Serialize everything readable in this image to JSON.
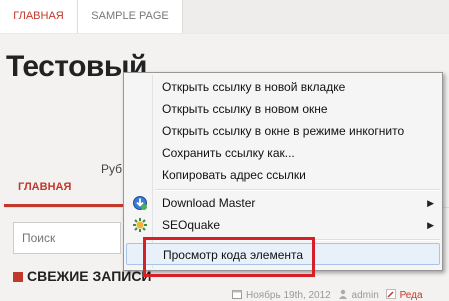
{
  "nav": {
    "tabs": [
      {
        "label": "ГЛАВНАЯ"
      },
      {
        "label": "SAMPLE PAGE"
      }
    ]
  },
  "site": {
    "title": "Тестовый",
    "rubric_label": "Руб",
    "main_tab": "ГЛАВНАЯ",
    "search_placeholder": "Поиск",
    "recent_posts_title": "СВЕЖИЕ ЗАПИСИ",
    "post_meta": {
      "date": "Ноябрь 19th, 2012",
      "author": "admin",
      "edit": "Реда"
    },
    "accent_color": "#c0392b"
  },
  "context_menu": {
    "items": [
      {
        "label": "Открыть ссылку в новой вкладке"
      },
      {
        "label": "Открыть ссылку в новом окне"
      },
      {
        "label": "Открыть ссылку в окне в режиме инкогнито"
      },
      {
        "label": "Сохранить ссылку как..."
      },
      {
        "label": "Копировать адрес ссылки"
      },
      {
        "label": "Download Master",
        "icon": "download-master-icon",
        "submenu": true
      },
      {
        "label": "SEOquake",
        "icon": "seoquake-icon",
        "submenu": true
      },
      {
        "label": "Просмотр кода элемента",
        "highlighted": true
      }
    ],
    "highlight_color": "#d61f26"
  }
}
